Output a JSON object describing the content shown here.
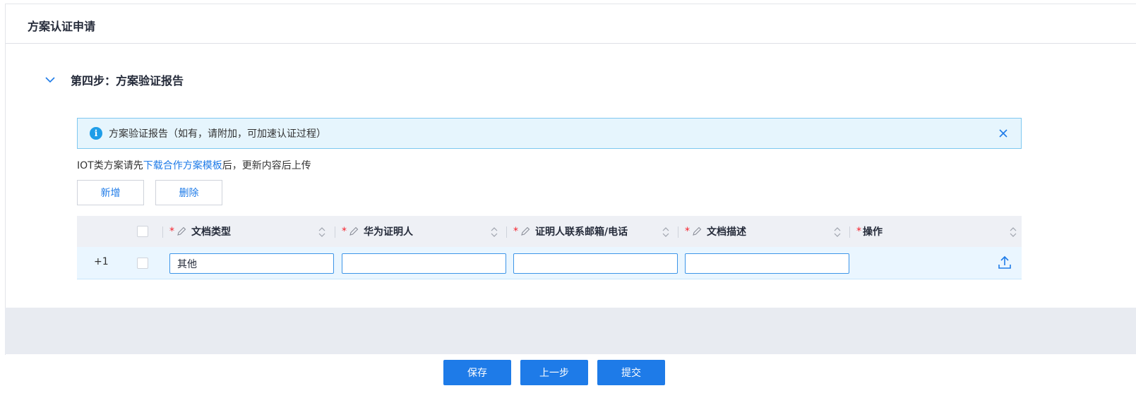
{
  "card": {
    "title": "方案认证申请"
  },
  "step": {
    "title": "第四步：方案验证报告"
  },
  "alert": {
    "text": "方案验证报告（如有，请附加，可加速认证过程）"
  },
  "hint": {
    "prefix": "IOT类方案请先",
    "link": "下载合作方案模板",
    "suffix": "后，更新内容后上传"
  },
  "toolbar": {
    "add_label": "新增",
    "delete_label": "删除"
  },
  "table": {
    "columns": [
      {
        "label": "文档类型",
        "required": true,
        "editable": true
      },
      {
        "label": "华为证明人",
        "required": true,
        "editable": true
      },
      {
        "label": "证明人联系邮箱/电话",
        "required": true,
        "editable": true
      },
      {
        "label": "文档描述",
        "required": true,
        "editable": true
      },
      {
        "label": "操作",
        "required": true,
        "editable": false
      }
    ],
    "required_mark": "*",
    "rows": [
      {
        "index": "+1",
        "doc_type": "其他",
        "witness": "",
        "contact": "",
        "description": ""
      }
    ]
  },
  "footer": {
    "save_label": "保存",
    "prev_label": "上一步",
    "submit_label": "提交"
  },
  "colors": {
    "primary": "#1e7be8",
    "alert_bg": "#e6f5fd",
    "required": "#f5222d"
  },
  "icons": {
    "collapse": "chevron-down-icon",
    "info": "info-icon",
    "close": "close-icon",
    "edit": "pencil-icon",
    "sort": "sort-icon",
    "upload": "upload-icon"
  }
}
